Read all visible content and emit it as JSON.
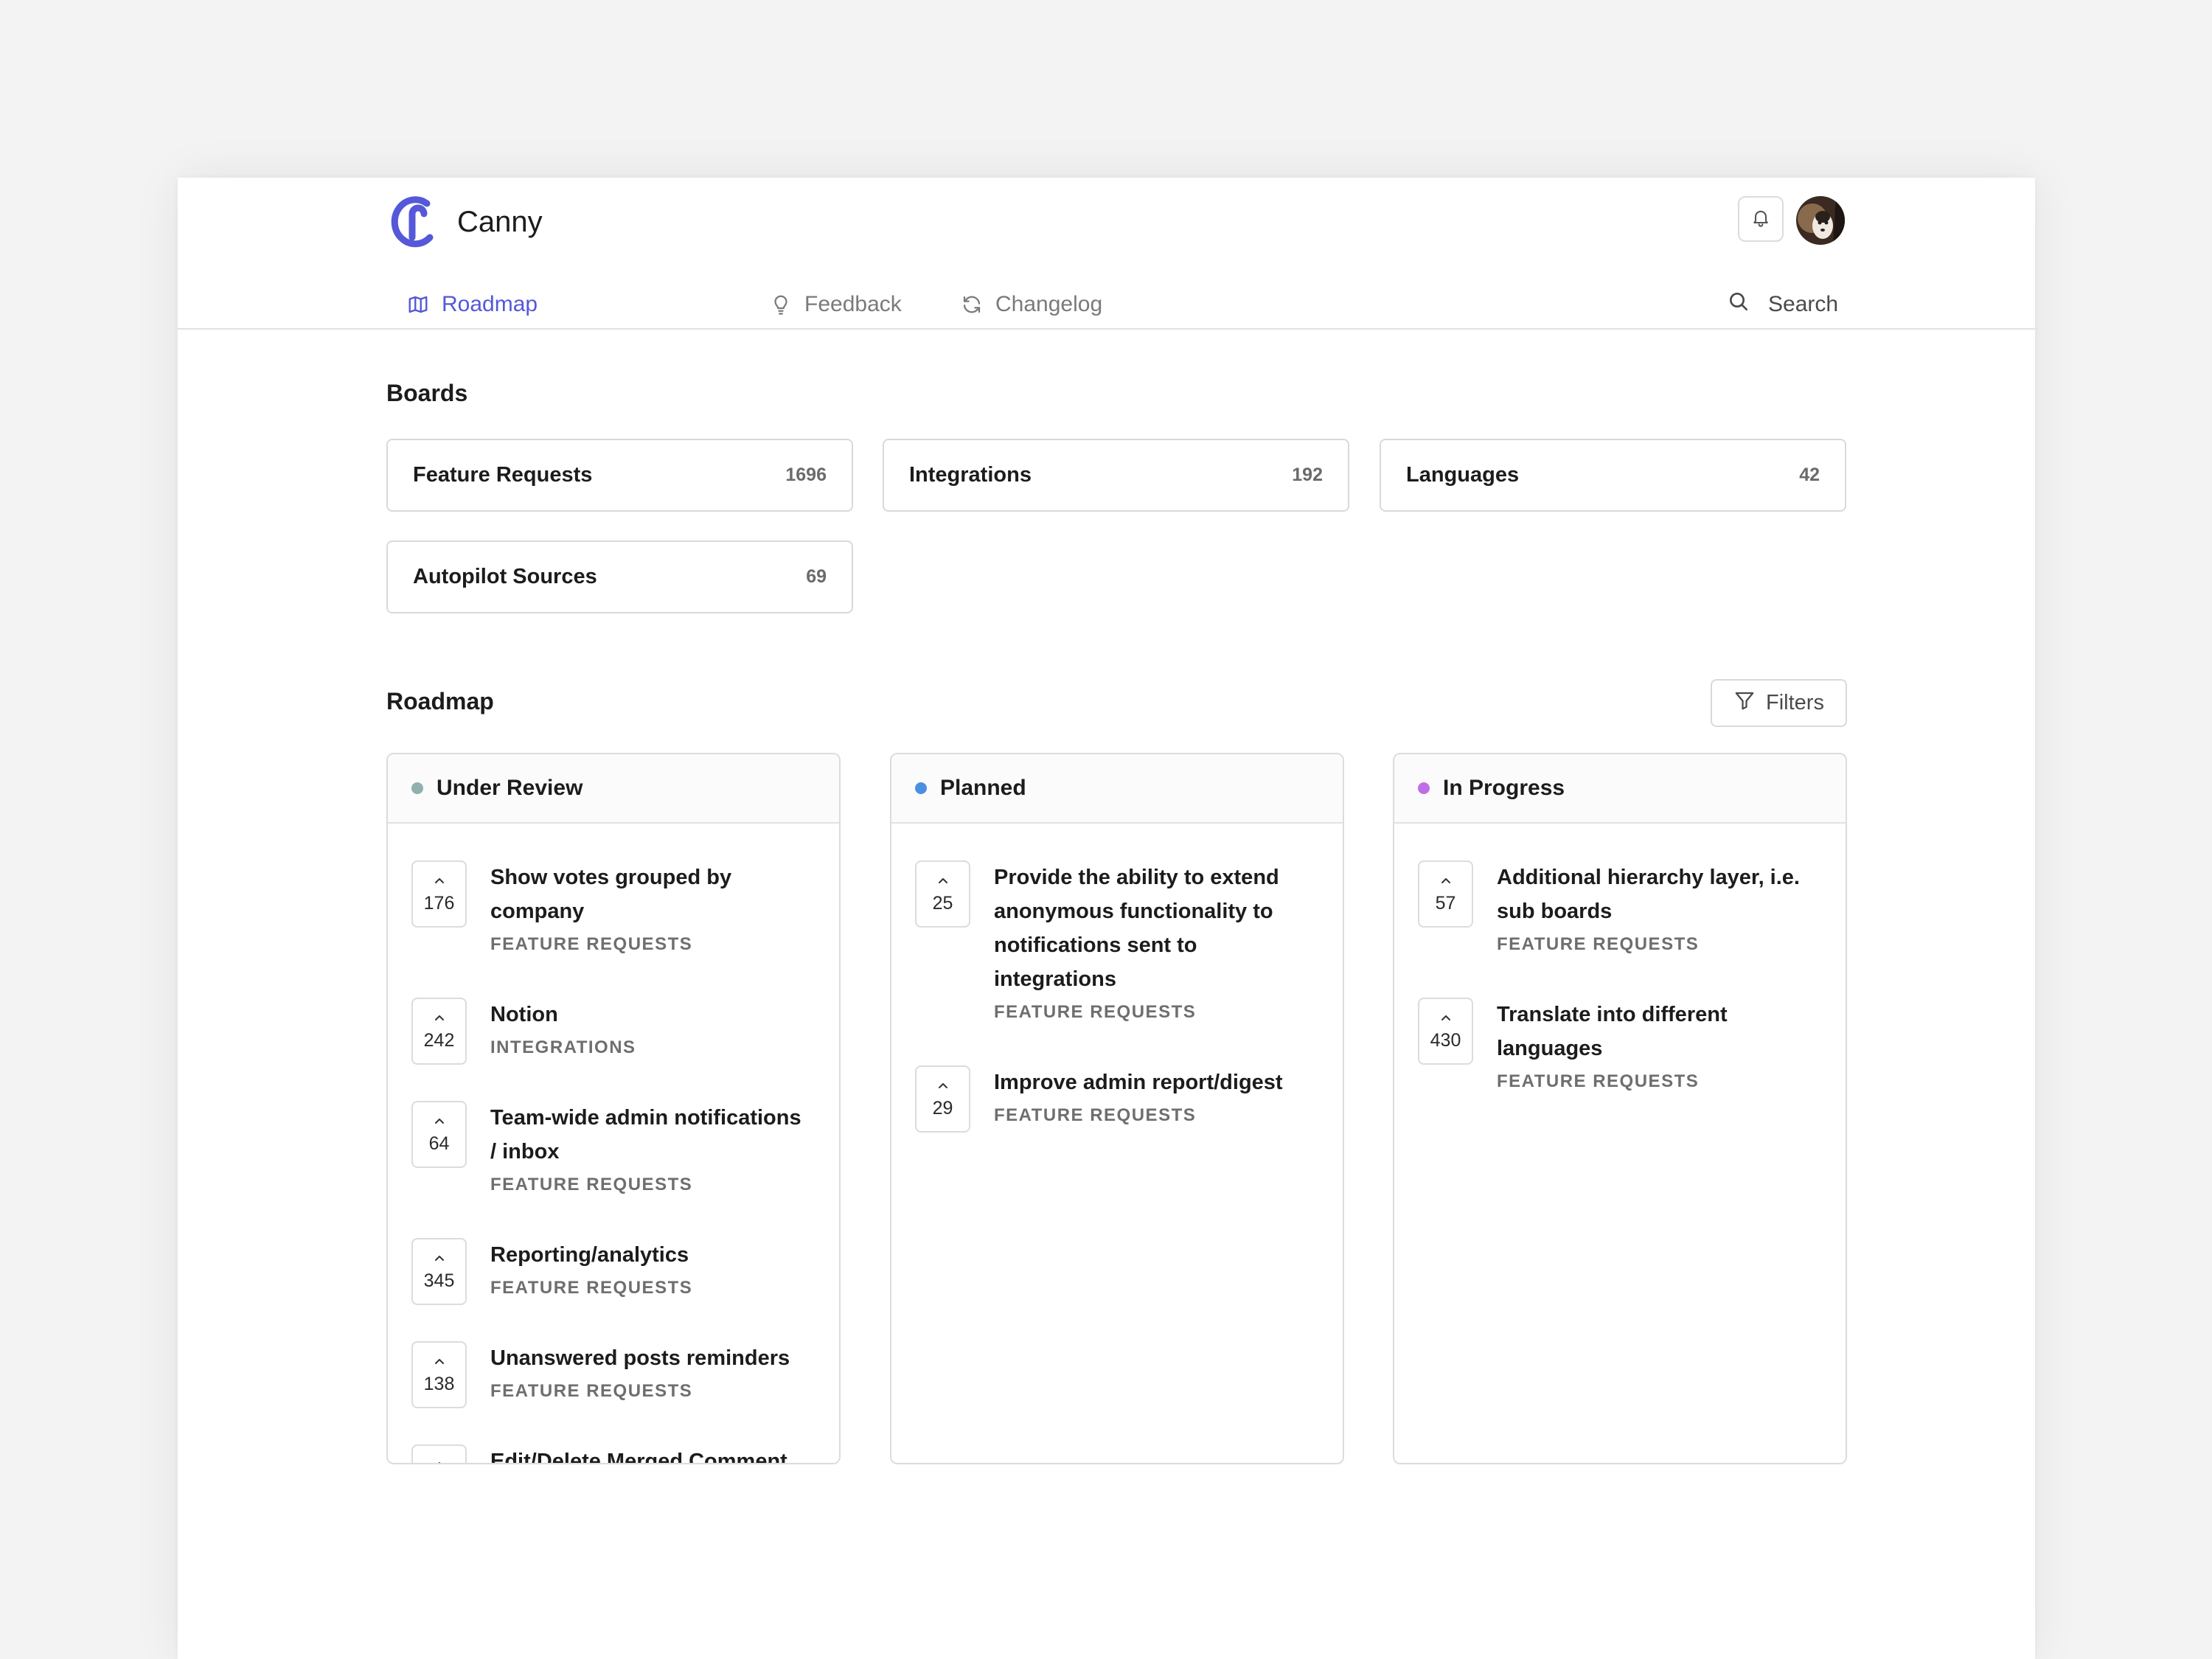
{
  "app": {
    "name": "Canny",
    "brand_color": "#5558d8"
  },
  "nav": {
    "items": [
      {
        "label": "Roadmap",
        "icon": "map-icon",
        "active": true
      },
      {
        "label": "Feedback",
        "icon": "lightbulb-icon",
        "active": false
      },
      {
        "label": "Changelog",
        "icon": "refresh-icon",
        "active": false
      }
    ],
    "search_label": "Search"
  },
  "boards": {
    "title": "Boards",
    "items": [
      {
        "name": "Feature Requests",
        "count": "1696"
      },
      {
        "name": "Integrations",
        "count": "192"
      },
      {
        "name": "Languages",
        "count": "42"
      },
      {
        "name": "Autopilot Sources",
        "count": "69"
      }
    ]
  },
  "roadmap": {
    "title": "Roadmap",
    "filters_label": "Filters",
    "columns": [
      {
        "title": "Under Review",
        "dot_color": "#8fb0ac",
        "posts": [
          {
            "votes": "176",
            "title": "Show votes grouped by company",
            "board": "FEATURE REQUESTS"
          },
          {
            "votes": "242",
            "title": "Notion",
            "board": "INTEGRATIONS"
          },
          {
            "votes": "64",
            "title": "Team-wide admin notifications / inbox",
            "board": "FEATURE REQUESTS"
          },
          {
            "votes": "345",
            "title": "Reporting/analytics",
            "board": "FEATURE REQUESTS"
          },
          {
            "votes": "138",
            "title": "Unanswered posts reminders",
            "board": "FEATURE REQUESTS"
          },
          {
            "votes": "",
            "title": "Edit/Delete Merged Comment",
            "board": ""
          }
        ]
      },
      {
        "title": "Planned",
        "dot_color": "#4a90e2",
        "posts": [
          {
            "votes": "25",
            "title": "Provide the ability to extend anonymous functionality to notifications sent to integrations",
            "board": "FEATURE REQUESTS"
          },
          {
            "votes": "29",
            "title": "Improve admin report/digest",
            "board": "FEATURE REQUESTS"
          }
        ]
      },
      {
        "title": "In Progress",
        "dot_color": "#c06ee8",
        "posts": [
          {
            "votes": "57",
            "title": "Additional hierarchy layer, i.e. sub boards",
            "board": "FEATURE REQUESTS"
          },
          {
            "votes": "430",
            "title": "Translate into different languages",
            "board": "FEATURE REQUESTS"
          }
        ]
      }
    ]
  }
}
